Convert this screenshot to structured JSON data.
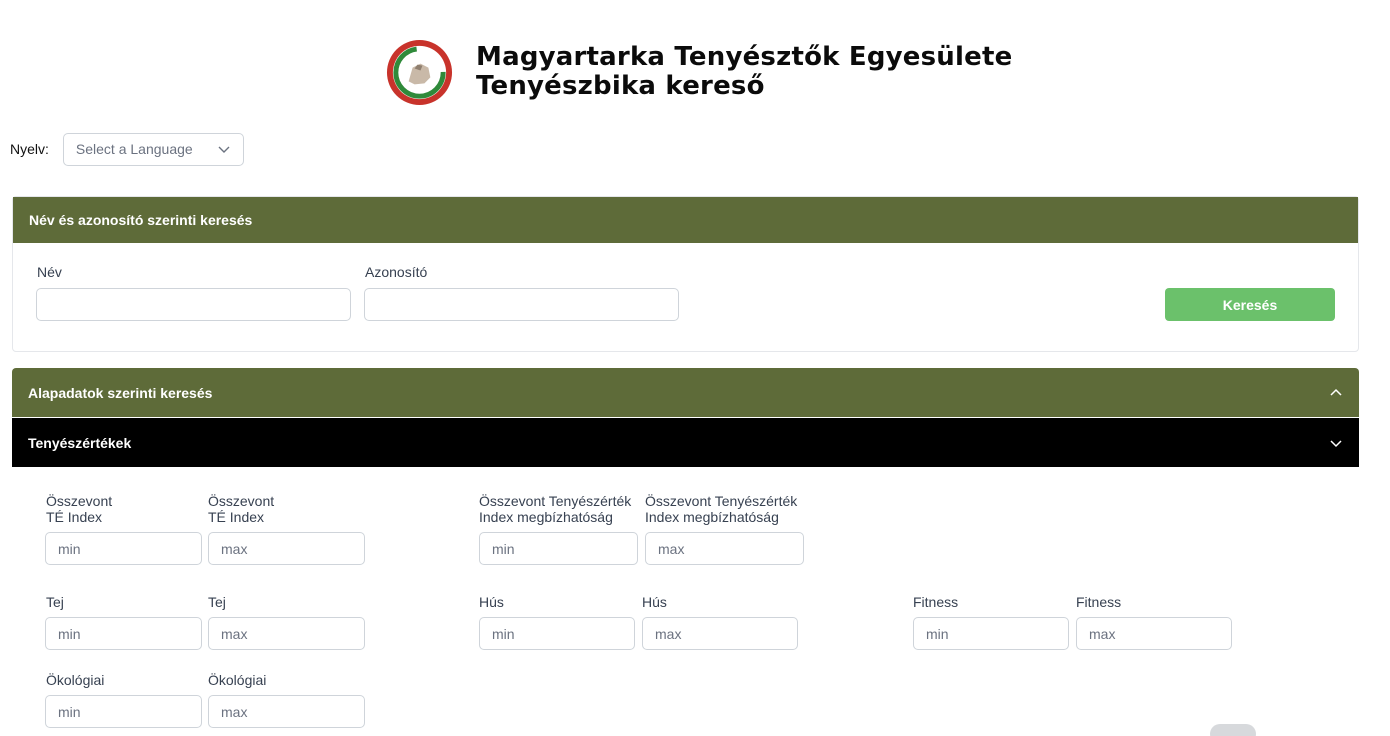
{
  "header": {
    "title_line1": "Magyartarka Tenyésztők Egyesülete",
    "title_line2": "Tenyészbika kereső"
  },
  "language": {
    "label": "Nyelv:",
    "placeholder": "Select a Language"
  },
  "name_search": {
    "title": "Név és azonosító szerinti keresés",
    "name_label": "Név",
    "name_value": "",
    "id_label": "Azonosító",
    "id_value": "",
    "button_label": "Keresés"
  },
  "accordions": {
    "basic": {
      "title": "Alapadatok szerinti keresés",
      "state": "expanded"
    },
    "breeding": {
      "title": "Tenyészértékek",
      "state": "collapsed"
    }
  },
  "ranges": {
    "total_min_label_1": "Összevont",
    "total_min_label_2": "TÉ Index",
    "total_max_label_1": "Összevont",
    "total_max_label_2": "TÉ Index",
    "rel_min_label_1": "Összevont Tenyészérték",
    "rel_min_label_2": "Index megbízhatóság",
    "rel_max_label_1": "Összevont Tenyészérték",
    "rel_max_label_2": "Index megbízhatóság",
    "milk_min_label": "Tej",
    "milk_max_label": "Tej",
    "meat_min_label": "Hús",
    "meat_max_label": "Hús",
    "fitness_min_label": "Fitness",
    "fitness_max_label": "Fitness",
    "eco_min_label": "Ökológiai",
    "eco_max_label": "Ökológiai",
    "min_placeholder": "min",
    "max_placeholder": "max"
  },
  "colors": {
    "panel_header": "#5e6b39",
    "accordion_dark": "#000000",
    "search_button": "#6bc16b",
    "logo_red": "#c8332b",
    "logo_green": "#2f8a3a"
  }
}
